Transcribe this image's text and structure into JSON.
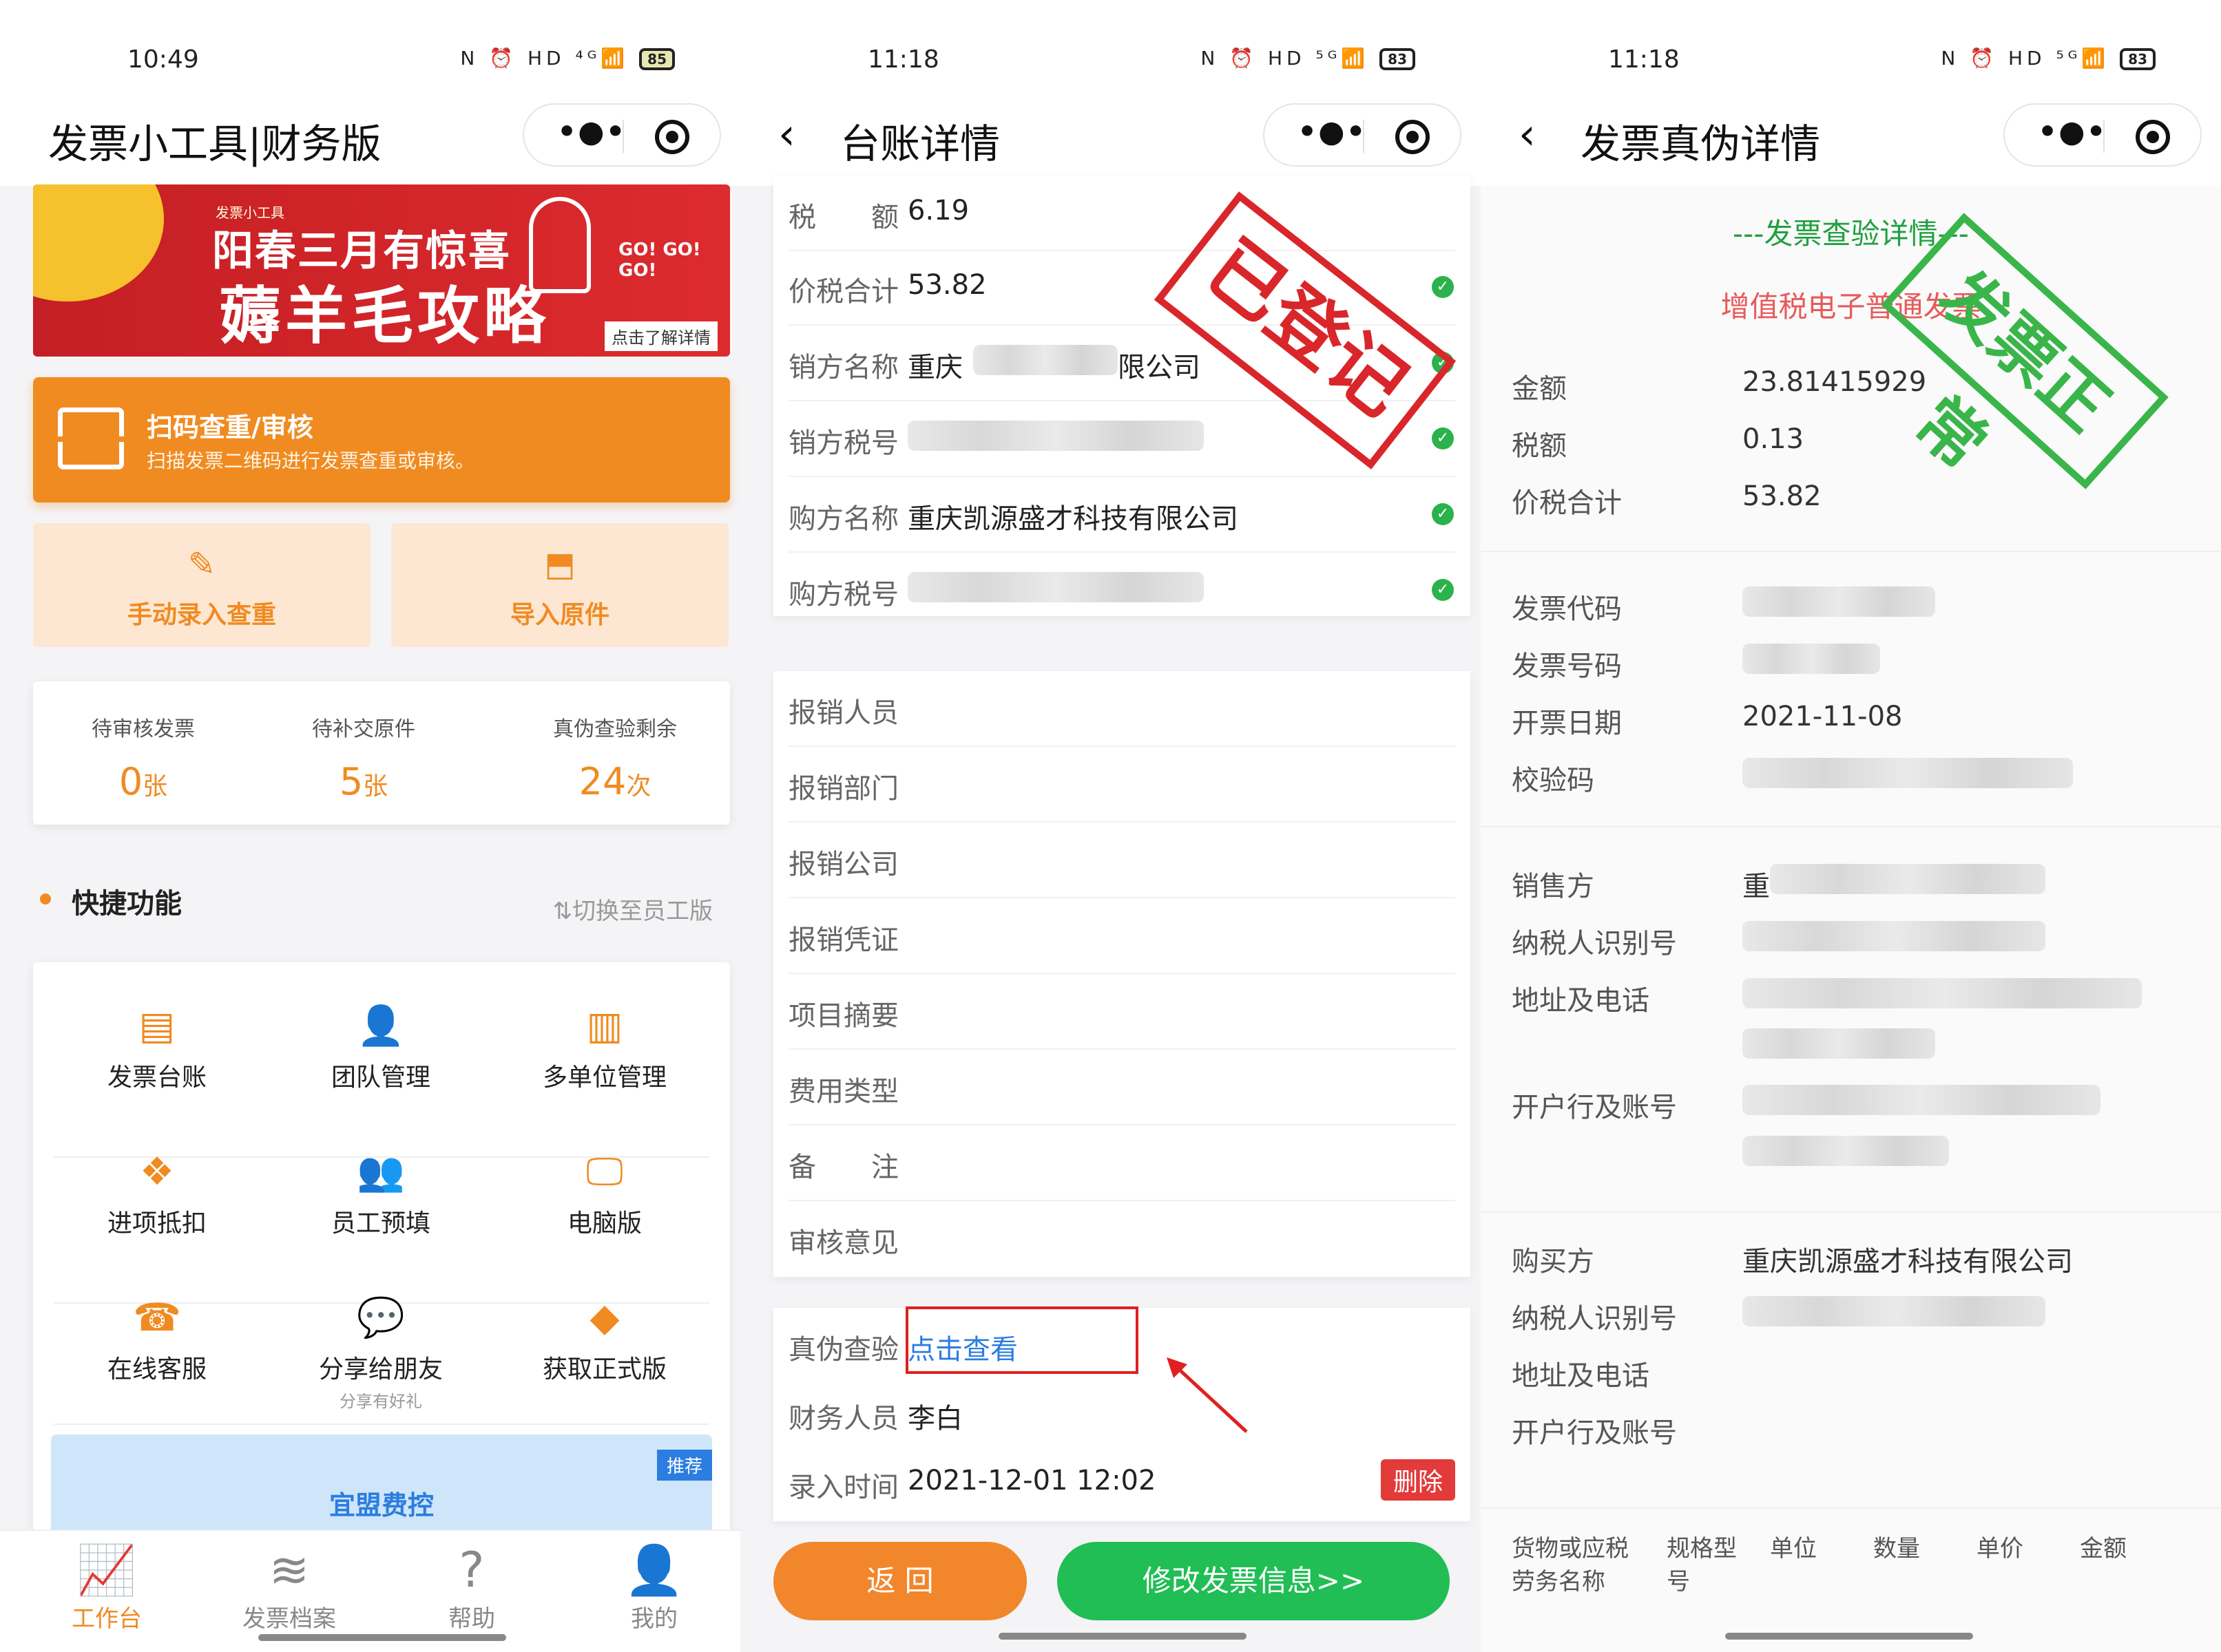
{
  "colors": {
    "orange": "#f08b21",
    "green": "#20be54",
    "red": "#e02020",
    "blue": "#2b7de0"
  },
  "phone1": {
    "status": {
      "time": "10:49",
      "icons": "N ⏰ HD ⁴ᴳ📶",
      "battery": "85"
    },
    "nav": {
      "title": "发票小工具|财务版"
    },
    "banner": {
      "small": "发票小工具",
      "line1": "阳春三月有惊喜",
      "line2": "薅羊毛攻略",
      "go": "GO! GO! GO!",
      "more": "点击了解详情"
    },
    "scan": {
      "title": "扫码查重/审核",
      "subtitle": "扫描发票二维码进行发票查重或审核。"
    },
    "actions": [
      {
        "label": "手动录入查重",
        "icon": "edit-icon"
      },
      {
        "label": "导入原件",
        "icon": "import-icon"
      }
    ],
    "stats": [
      {
        "label": "待审核发票",
        "value": "0",
        "unit": "张"
      },
      {
        "label": "待补交原件",
        "value": "5",
        "unit": "张"
      },
      {
        "label": "真伪查验剩余",
        "value": "24",
        "unit": "次"
      }
    ],
    "quick": {
      "title": "快捷功能",
      "switch": "⇅切换至员工版"
    },
    "grid": [
      {
        "label": "发票台账",
        "icon": "ledger-icon",
        "glyph": "▤"
      },
      {
        "label": "团队管理",
        "icon": "team-icon",
        "glyph": "👤"
      },
      {
        "label": "多单位管理",
        "icon": "units-icon",
        "glyph": "▥"
      },
      {
        "label": "进项抵扣",
        "icon": "deduct-icon",
        "glyph": "❖"
      },
      {
        "label": "员工预填",
        "icon": "staff-icon",
        "glyph": "👥"
      },
      {
        "label": "电脑版",
        "icon": "monitor-icon",
        "glyph": "🖵"
      },
      {
        "label": "在线客服",
        "icon": "service-icon",
        "glyph": "☎"
      },
      {
        "label": "分享给朋友",
        "sub": "分享有好礼",
        "icon": "share-icon",
        "glyph": "💬"
      },
      {
        "label": "获取正式版",
        "icon": "diamond-icon",
        "glyph": "◆"
      }
    ],
    "promo": {
      "tag": "推荐",
      "title": "宜盟费控"
    },
    "tabs": [
      {
        "label": "工作台",
        "icon": "chart-icon",
        "glyph": "📈"
      },
      {
        "label": "发票档案",
        "icon": "layers-icon",
        "glyph": "≋"
      },
      {
        "label": "帮助",
        "icon": "help-icon",
        "glyph": "?"
      },
      {
        "label": "我的",
        "icon": "user-icon",
        "glyph": "👤"
      }
    ]
  },
  "phone2": {
    "status": {
      "time": "11:18",
      "icons": "N ⏰ HD ⁵ᴳ📶",
      "battery": "83"
    },
    "nav": {
      "title": "台账详情"
    },
    "info": [
      {
        "key": "税　　额",
        "value": "6.19"
      },
      {
        "key": "价税合计",
        "value": "53.82"
      },
      {
        "key": "销方名称",
        "value": "重庆",
        "suffix": "限公司"
      },
      {
        "key": "销方税号",
        "value": ""
      },
      {
        "key": "购方名称",
        "value": "重庆凯源盛才科技有限公司"
      },
      {
        "key": "购方税号",
        "value": ""
      }
    ],
    "stamp": "已登记",
    "fields": [
      "报销人员",
      "报销部门",
      "报销公司",
      "报销凭证",
      "项目摘要",
      "费用类型",
      "备　　注",
      "审核意见"
    ],
    "verify": {
      "key": "真伪查验",
      "link": "点击查看"
    },
    "finance": {
      "key": "财务人员",
      "value": "李白"
    },
    "entry": {
      "key": "录入时间",
      "value": "2021-12-01 12:02",
      "delete": "删除"
    },
    "buttons": {
      "back": "返 回",
      "edit": "修改发票信息>>"
    }
  },
  "phone3": {
    "status": {
      "time": "11:18",
      "icons": "N ⏰ HD ⁵ᴳ📶",
      "battery": "83"
    },
    "nav": {
      "title": "发票真伪详情"
    },
    "header": "---发票查验详情---",
    "type": "增值税电子普通发票",
    "stamp": "发票正常",
    "amounts": [
      {
        "key": "金额",
        "value": "23.81415929"
      },
      {
        "key": "税额",
        "value": "0.13"
      },
      {
        "key": "价税合计",
        "value": "53.82"
      }
    ],
    "invoice": [
      {
        "key": "发票代码",
        "value": ""
      },
      {
        "key": "发票号码",
        "value": ""
      },
      {
        "key": "开票日期",
        "value": "2021-11-08"
      },
      {
        "key": "校验码",
        "value": ""
      }
    ],
    "seller": [
      {
        "key": "销售方",
        "value": "重"
      },
      {
        "key": "纳税人识别号",
        "value": ""
      },
      {
        "key": "地址及电话",
        "value": ""
      },
      {
        "key": "开户行及账号",
        "value": ""
      }
    ],
    "buyer": [
      {
        "key": "购买方",
        "value": "重庆凯源盛才科技有限公司"
      },
      {
        "key": "纳税人识别号",
        "value": ""
      },
      {
        "key": "地址及电话",
        "value": ""
      },
      {
        "key": "开户行及账号",
        "value": ""
      }
    ],
    "table_headers": [
      "货物或应税劳务名称",
      "规格型号",
      "单位",
      "数量",
      "单价",
      "金额"
    ]
  }
}
